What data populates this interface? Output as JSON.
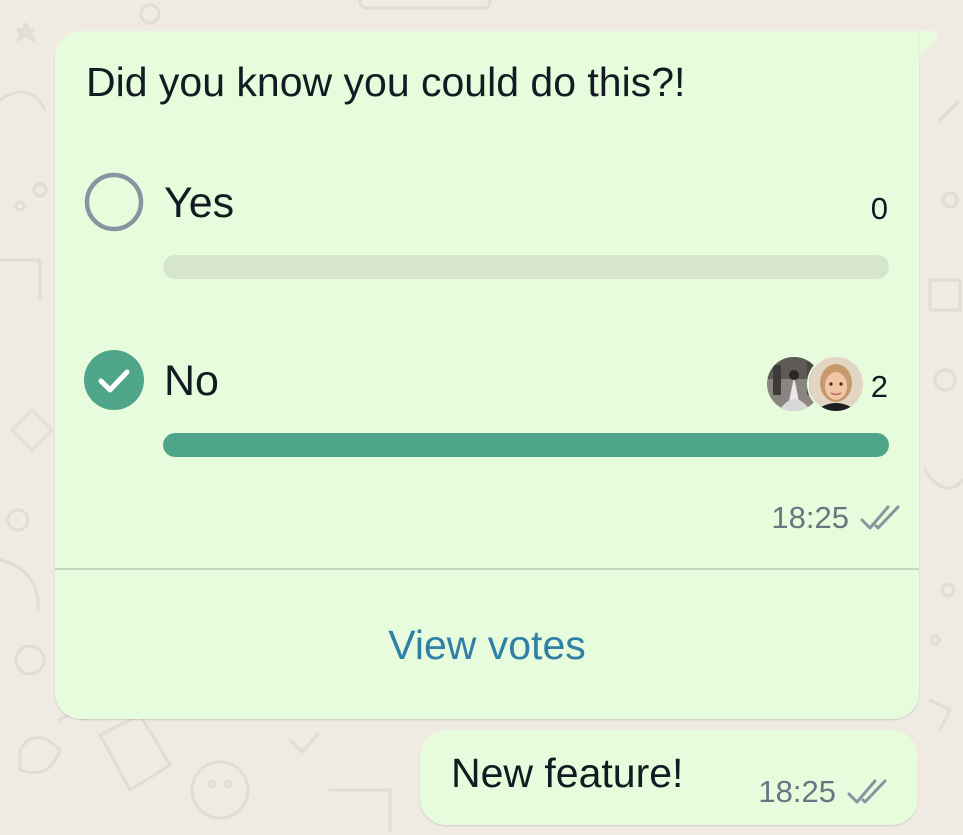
{
  "colors": {
    "wallpaper": "#efeae2",
    "bubble": "#e7fcdc",
    "accent_green": "#4ea58a",
    "bar_track": "#d5e6cb",
    "link_blue": "#2f7fa6",
    "meta_gray": "#667781",
    "text": "#111b21"
  },
  "poll": {
    "question": "Did you know you could do this?!",
    "options": [
      {
        "label": "Yes",
        "count": "0",
        "selected": false,
        "fraction": 0,
        "icon": "empty-radio-icon"
      },
      {
        "label": "No",
        "count": "2",
        "selected": true,
        "fraction": 1,
        "icon": "check-circle-icon",
        "voter_avatars": [
          "voter-avatar-1",
          "voter-avatar-2"
        ]
      }
    ],
    "time": "18:25",
    "status_icon": "double-check-icon",
    "view_votes_label": "View votes"
  },
  "message": {
    "text": "New feature!",
    "time": "18:25",
    "status_icon": "double-check-icon"
  }
}
